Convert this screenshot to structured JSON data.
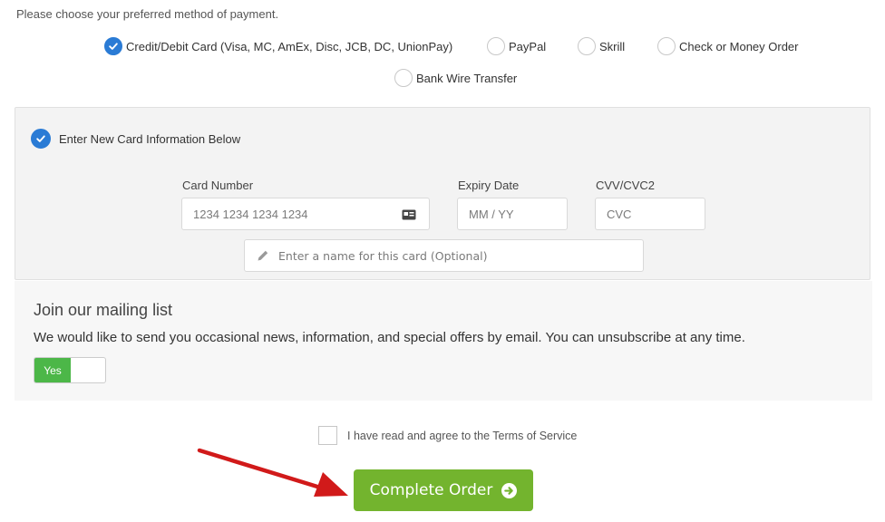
{
  "intro_text": "Please choose your preferred method of payment.",
  "payment_methods": [
    {
      "label": "Credit/Debit Card (Visa, MC, AmEx, Disc, JCB, DC, UnionPay)",
      "selected": true
    },
    {
      "label": "PayPal",
      "selected": false
    },
    {
      "label": "Skrill",
      "selected": false
    },
    {
      "label": "Check or Money Order",
      "selected": false
    },
    {
      "label": "Bank Wire Transfer",
      "selected": false
    }
  ],
  "card_panel": {
    "new_card_label": "Enter New Card Information Below",
    "card_number_label": "Card Number",
    "card_number_placeholder": "1234 1234 1234 1234",
    "expiry_label": "Expiry Date",
    "expiry_placeholder": "MM / YY",
    "cvv_label": "CVV/CVC2",
    "cvv_placeholder": "CVC",
    "card_name_placeholder": "Enter a name for this card (Optional)"
  },
  "mailing_list": {
    "title": "Join our mailing list",
    "description": "We would like to send you occasional news, information, and special offers by email. You can unsubscribe at any time.",
    "toggle_label": "Yes"
  },
  "tos_label": "I have read and agree to the Terms of Service",
  "complete_order_label": "Complete Order",
  "colors": {
    "accent_blue": "#2a7bd5",
    "button_green": "#73b42e",
    "toggle_green": "#4cb748",
    "annotation_red": "#d11a1a"
  },
  "icons": [
    "check-icon",
    "card-icon",
    "pencil-icon",
    "arrow-circle-right-icon"
  ]
}
